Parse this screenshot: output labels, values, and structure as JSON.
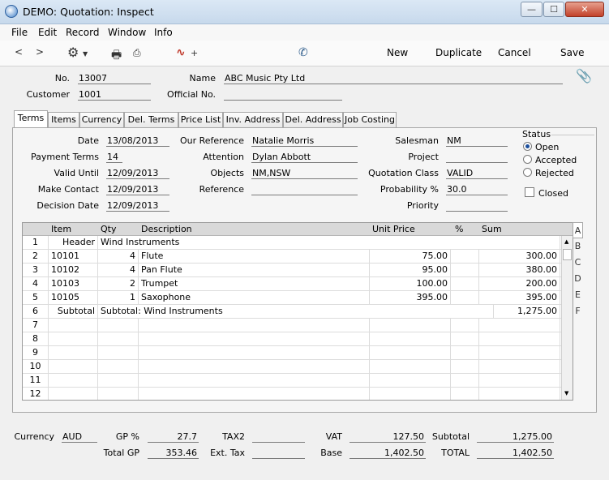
{
  "window": {
    "title": "DEMO: Quotation: Inspect"
  },
  "menu": [
    "File",
    "Edit",
    "Record",
    "Window",
    "Info"
  ],
  "toolbar": {
    "new_label": "New",
    "duplicate_label": "Duplicate",
    "cancel_label": "Cancel",
    "save_label": "Save"
  },
  "header": {
    "no_label": "No.",
    "no_value": "13007",
    "customer_label": "Customer",
    "customer_value": "1001",
    "name_label": "Name",
    "name_value": "ABC Music Pty Ltd",
    "official_label": "Official No.",
    "official_value": ""
  },
  "tabs": [
    "Terms",
    "Items",
    "Currency",
    "Del. Terms",
    "Price List",
    "Inv. Address",
    "Del. Address",
    "Job Costing"
  ],
  "terms": {
    "date_label": "Date",
    "date_value": "13/08/2013",
    "payment_terms_label": "Payment Terms",
    "payment_terms_value": "14",
    "valid_until_label": "Valid Until",
    "valid_until_value": "12/09/2013",
    "make_contact_label": "Make Contact",
    "make_contact_value": "12/09/2013",
    "decision_date_label": "Decision Date",
    "decision_date_value": "12/09/2013",
    "our_reference_label": "Our Reference",
    "our_reference_value": "Natalie Morris",
    "attention_label": "Attention",
    "attention_value": "Dylan Abbott",
    "objects_label": "Objects",
    "objects_value": "NM,NSW",
    "reference_label": "Reference",
    "reference_value": "",
    "salesman_label": "Salesman",
    "salesman_value": "NM",
    "project_label": "Project",
    "project_value": "",
    "quotation_class_label": "Quotation Class",
    "quotation_class_value": "VALID",
    "probability_label": "Probability %",
    "probability_value": "30.0",
    "priority_label": "Priority",
    "priority_value": "",
    "status_label": "Status",
    "status_options": [
      "Open",
      "Accepted",
      "Rejected"
    ],
    "status_selected": "Open",
    "closed_label": "Closed"
  },
  "grid": {
    "columns": [
      "Item",
      "Qty",
      "Description",
      "Unit Price",
      "%",
      "Sum"
    ],
    "rows": [
      {
        "n": "1",
        "item": "Header",
        "qty": "",
        "desc": "Wind Instruments",
        "price": "",
        "pct": "",
        "sum": ""
      },
      {
        "n": "2",
        "item": "10101",
        "qty": "4",
        "desc": "Flute",
        "price": "75.00",
        "pct": "",
        "sum": "300.00"
      },
      {
        "n": "3",
        "item": "10102",
        "qty": "4",
        "desc": "Pan Flute",
        "price": "95.00",
        "pct": "",
        "sum": "380.00"
      },
      {
        "n": "4",
        "item": "10103",
        "qty": "2",
        "desc": "Trumpet",
        "price": "100.00",
        "pct": "",
        "sum": "200.00"
      },
      {
        "n": "5",
        "item": "10105",
        "qty": "1",
        "desc": "Saxophone",
        "price": "395.00",
        "pct": "",
        "sum": "395.00"
      },
      {
        "n": "6",
        "item": "Subtotal",
        "qty": "",
        "desc": "Subtotal: Wind Instruments",
        "price": "",
        "pct": "",
        "sum": "1,275.00"
      },
      {
        "n": "7",
        "item": "",
        "qty": "",
        "desc": "",
        "price": "",
        "pct": "",
        "sum": ""
      },
      {
        "n": "8",
        "item": "",
        "qty": "",
        "desc": "",
        "price": "",
        "pct": "",
        "sum": ""
      },
      {
        "n": "9",
        "item": "",
        "qty": "",
        "desc": "",
        "price": "",
        "pct": "",
        "sum": ""
      },
      {
        "n": "10",
        "item": "",
        "qty": "",
        "desc": "",
        "price": "",
        "pct": "",
        "sum": ""
      },
      {
        "n": "11",
        "item": "",
        "qty": "",
        "desc": "",
        "price": "",
        "pct": "",
        "sum": ""
      },
      {
        "n": "12",
        "item": "",
        "qty": "",
        "desc": "",
        "price": "",
        "pct": "",
        "sum": ""
      }
    ],
    "side_tabs": [
      "A",
      "B",
      "C",
      "D",
      "E",
      "F"
    ]
  },
  "footer": {
    "currency_label": "Currency",
    "currency_value": "AUD",
    "gp_pct_label": "GP %",
    "gp_pct_value": "27.7",
    "total_gp_label": "Total GP",
    "total_gp_value": "353.46",
    "tax2_label": "TAX2",
    "tax2_value": "",
    "ext_tax_label": "Ext. Tax",
    "ext_tax_value": "",
    "vat_label": "VAT",
    "vat_value": "127.50",
    "base_label": "Base",
    "base_value": "1,402.50",
    "subtotal_label": "Subtotal",
    "subtotal_value": "1,275.00",
    "total_label": "TOTAL",
    "total_value": "1,402.50"
  }
}
